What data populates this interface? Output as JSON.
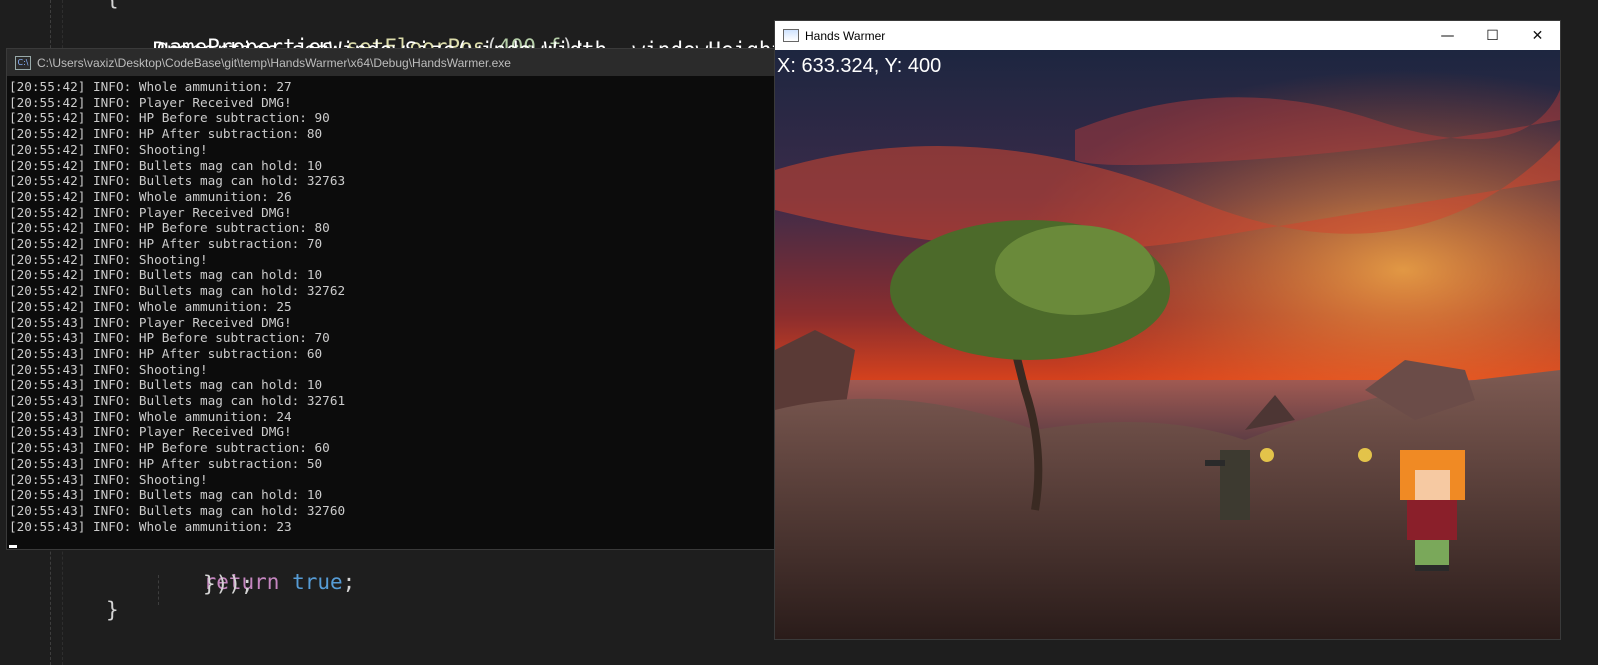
{
  "editor": {
    "line_top": {
      "obj": "gameProperties",
      "dot": ".",
      "fn": "setFloorPos",
      "open": "(",
      "num": "400.f",
      "close": ");"
    },
    "line_hidden": "Properties.setWindowSize(windowWidth, windowHeight",
    "line_return": {
      "kw": "return",
      "val": "true",
      "semi": ";"
    },
    "line_close1": "}));",
    "line_close2": "}",
    "brace_top": "{"
  },
  "console": {
    "title": "C:\\Users\\vaxiz\\Desktop\\CodeBase\\git\\temp\\HandsWarmer\\x64\\Debug\\HandsWarmer.exe",
    "icon": "cmd-icon",
    "lines": [
      "[20:55:42] INFO: Whole ammunition: 27",
      "[20:55:42] INFO: Player Received DMG!",
      "[20:55:42] INFO: HP Before subtraction: 90",
      "[20:55:42] INFO: HP After subtraction: 80",
      "[20:55:42] INFO: Shooting!",
      "[20:55:42] INFO: Bullets mag can hold: 10",
      "[20:55:42] INFO: Bullets mag can hold: 32763",
      "[20:55:42] INFO: Whole ammunition: 26",
      "[20:55:42] INFO: Player Received DMG!",
      "[20:55:42] INFO: HP Before subtraction: 80",
      "[20:55:42] INFO: HP After subtraction: 70",
      "[20:55:42] INFO: Shooting!",
      "[20:55:42] INFO: Bullets mag can hold: 10",
      "[20:55:42] INFO: Bullets mag can hold: 32762",
      "[20:55:42] INFO: Whole ammunition: 25",
      "[20:55:43] INFO: Player Received DMG!",
      "[20:55:43] INFO: HP Before subtraction: 70",
      "[20:55:43] INFO: HP After subtraction: 60",
      "[20:55:43] INFO: Shooting!",
      "[20:55:43] INFO: Bullets mag can hold: 10",
      "[20:55:43] INFO: Bullets mag can hold: 32761",
      "[20:55:43] INFO: Whole ammunition: 24",
      "[20:55:43] INFO: Player Received DMG!",
      "[20:55:43] INFO: HP Before subtraction: 60",
      "[20:55:43] INFO: HP After subtraction: 50",
      "[20:55:43] INFO: Shooting!",
      "[20:55:43] INFO: Bullets mag can hold: 10",
      "[20:55:43] INFO: Bullets mag can hold: 32760",
      "[20:55:43] INFO: Whole ammunition: 23"
    ]
  },
  "game": {
    "title": "Hands Warmer",
    "coords": "X: 633.324, Y: 400",
    "controls": {
      "minimize": "—",
      "maximize": "☐",
      "close": "✕"
    }
  }
}
